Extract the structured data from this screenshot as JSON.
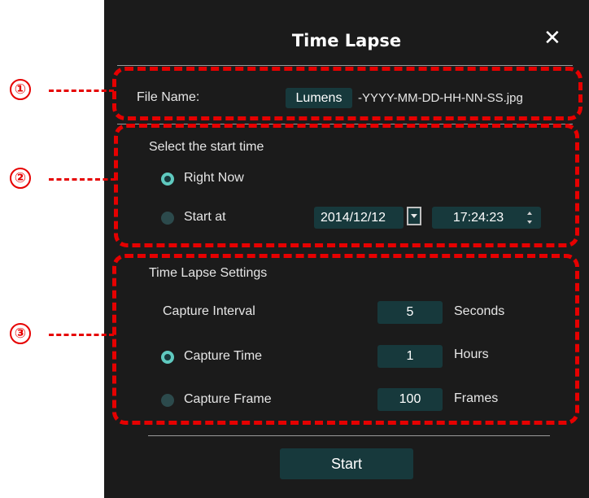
{
  "dialog": {
    "title": "Time Lapse",
    "close": "✕"
  },
  "file_name": {
    "label": "File Name:",
    "value": "Lumens",
    "suffix": "-YYYY-MM-DD-HH-NN-SS.jpg"
  },
  "start_time": {
    "heading": "Select the start time",
    "right_now_label": "Right Now",
    "right_now_selected": true,
    "start_at_label": "Start at",
    "start_at_selected": false,
    "date": "2014/12/12",
    "time": "17:24:23"
  },
  "settings": {
    "heading": "Time Lapse Settings",
    "interval_label": "Capture Interval",
    "interval_value": "5",
    "interval_unit": "Seconds",
    "capture_time_label": "Capture Time",
    "capture_time_selected": true,
    "capture_time_value": "1",
    "capture_time_unit": "Hours",
    "capture_frame_label": "Capture Frame",
    "capture_frame_selected": false,
    "capture_frame_value": "100",
    "capture_frame_unit": "Frames"
  },
  "start_button": "Start",
  "callouts": [
    "①",
    "②",
    "③"
  ],
  "colors": {
    "dialog_bg": "#1b1b1b",
    "field_bg": "#17393c",
    "radio_on": "#5fc9bf",
    "callout_red": "#e60000"
  }
}
